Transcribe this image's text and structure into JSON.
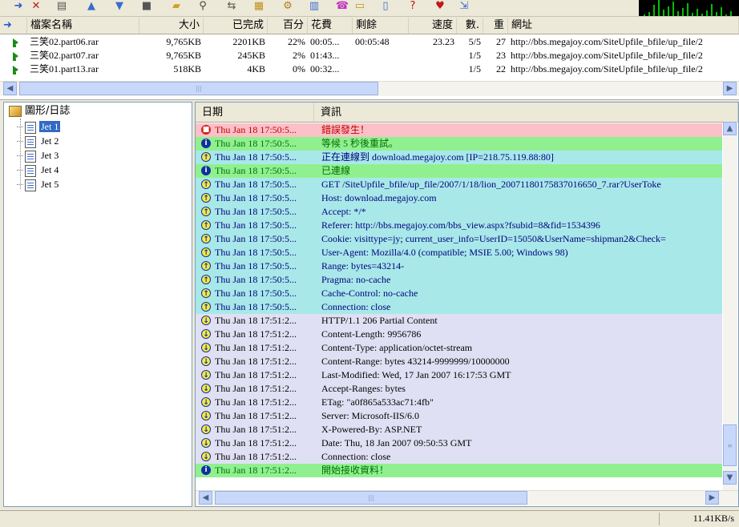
{
  "toolbar": {
    "buttons": [
      {
        "name": "add-icon",
        "glyph": "➜",
        "color": "#2a5bd0"
      },
      {
        "name": "delete-icon",
        "glyph": "✕",
        "color": "#c01818"
      },
      {
        "name": "trash-icon",
        "glyph": "▤",
        "color": "#555555"
      },
      {
        "name": "move-up-icon",
        "glyph": "▲",
        "color": "#3a6bd0"
      },
      {
        "name": "move-down-icon",
        "glyph": "▼",
        "color": "#3a6bd0"
      },
      {
        "name": "stop-all-icon",
        "glyph": "■",
        "color": "#555555"
      },
      {
        "name": "open-folder-icon",
        "glyph": "▰",
        "color": "#d0a020"
      },
      {
        "name": "find-icon",
        "glyph": "⚲",
        "color": "#444444"
      },
      {
        "name": "properties-icon",
        "glyph": "⇆",
        "color": "#555555"
      },
      {
        "name": "schedule-icon",
        "glyph": "▦",
        "color": "#c09020"
      },
      {
        "name": "options-icon",
        "glyph": "⚙",
        "color": "#b08020"
      },
      {
        "name": "site-manager-icon",
        "glyph": "▥",
        "color": "#3a6bd0"
      },
      {
        "name": "dial-icon",
        "glyph": "☎",
        "color": "#c030c0"
      },
      {
        "name": "modem-icon",
        "glyph": "▭",
        "color": "#c09020"
      },
      {
        "name": "notes-icon",
        "glyph": "▯",
        "color": "#3a6bd0"
      },
      {
        "name": "help-icon",
        "glyph": "?",
        "color": "#c01818"
      },
      {
        "name": "favorites-icon",
        "glyph": "♥",
        "color": "#c01818"
      },
      {
        "name": "exit-icon",
        "glyph": "⇲",
        "color": "#3a6bd0"
      }
    ],
    "graph_spikes": [
      2,
      5,
      14,
      20,
      8,
      12,
      18,
      6,
      10,
      16,
      4,
      9,
      3,
      7,
      15,
      5,
      11,
      2,
      6
    ]
  },
  "downloads": {
    "columns": [
      {
        "label": "檔案名稱",
        "align": "l"
      },
      {
        "label": "大小",
        "align": "r"
      },
      {
        "label": "已完成",
        "align": "r"
      },
      {
        "label": "百分",
        "align": "r"
      },
      {
        "label": "花費",
        "align": "l"
      },
      {
        "label": "剩餘",
        "align": "l"
      },
      {
        "label": "速度",
        "align": "r"
      },
      {
        "label": "數.",
        "align": "r"
      },
      {
        "label": "重",
        "align": "r"
      },
      {
        "label": "網址",
        "align": "l"
      }
    ],
    "rows": [
      [
        "三笑02.part06.rar",
        "9,765KB",
        "2201KB",
        "22%",
        "00:05...",
        "00:05:48",
        "23.23",
        "5/5",
        "27",
        "http://bbs.megajoy.com/SiteUpfile_bfile/up_file/2"
      ],
      [
        "三笑02.part07.rar",
        "9,765KB",
        "245KB",
        "2%",
        "01:43...",
        "",
        "",
        "1/5",
        "23",
        "http://bbs.megajoy.com/SiteUpfile_bfile/up_file/2"
      ],
      [
        "三笑01.part13.rar",
        "518KB",
        "4KB",
        "0%",
        "00:32...",
        "",
        "",
        "1/5",
        "22",
        "http://bbs.megajoy.com/SiteUpfile_bfile/up_file/2"
      ]
    ]
  },
  "tree": {
    "root": "圖形/日誌",
    "items": [
      "Jet 1",
      "Jet 2",
      "Jet 3",
      "Jet 4",
      "Jet 5"
    ],
    "selected": 0
  },
  "log": {
    "columns": [
      "日期",
      "資訊"
    ],
    "rows": [
      {
        "t": "err",
        "d": "Thu Jan 18 17:50:5...",
        "m": "錯誤發生！"
      },
      {
        "t": "info",
        "d": "Thu Jan 18 17:50:5...",
        "m": "等候 5 秒後重試。"
      },
      {
        "t": "send",
        "d": "Thu Jan 18 17:50:5...",
        "m": "正在連線到 download.megajoy.com [IP=218.75.119.88:80]"
      },
      {
        "t": "info",
        "d": "Thu Jan 18 17:50:5...",
        "m": "已連線"
      },
      {
        "t": "send",
        "d": "Thu Jan 18 17:50:5...",
        "m": "GET /SiteUpfile_bfile/up_file/2007/1/18/lion_20071180175837016650_7.rar?UserToke"
      },
      {
        "t": "send",
        "d": "Thu Jan 18 17:50:5...",
        "m": "Host: download.megajoy.com"
      },
      {
        "t": "send",
        "d": "Thu Jan 18 17:50:5...",
        "m": "Accept: */*"
      },
      {
        "t": "send",
        "d": "Thu Jan 18 17:50:5...",
        "m": "Referer: http://bbs.megajoy.com/bbs_view.aspx?fsubid=8&fid=1534396"
      },
      {
        "t": "send",
        "d": "Thu Jan 18 17:50:5...",
        "m": "Cookie: visittype=jy; current_user_info=UserID=15050&UserName=shipman2&Check="
      },
      {
        "t": "send",
        "d": "Thu Jan 18 17:50:5...",
        "m": "User-Agent: Mozilla/4.0 (compatible; MSIE 5.00; Windows 98)"
      },
      {
        "t": "send",
        "d": "Thu Jan 18 17:50:5...",
        "m": "Range: bytes=43214-"
      },
      {
        "t": "send",
        "d": "Thu Jan 18 17:50:5...",
        "m": "Pragma: no-cache"
      },
      {
        "t": "send",
        "d": "Thu Jan 18 17:50:5...",
        "m": "Cache-Control: no-cache"
      },
      {
        "t": "send",
        "d": "Thu Jan 18 17:50:5...",
        "m": "Connection: close"
      },
      {
        "t": "recv",
        "d": "Thu Jan 18 17:51:2...",
        "m": "HTTP/1.1 206 Partial Content"
      },
      {
        "t": "recv",
        "d": "Thu Jan 18 17:51:2...",
        "m": "Content-Length: 9956786"
      },
      {
        "t": "recv",
        "d": "Thu Jan 18 17:51:2...",
        "m": "Content-Type: application/octet-stream"
      },
      {
        "t": "recv",
        "d": "Thu Jan 18 17:51:2...",
        "m": "Content-Range: bytes 43214-9999999/10000000"
      },
      {
        "t": "recv",
        "d": "Thu Jan 18 17:51:2...",
        "m": "Last-Modified: Wed, 17 Jan 2007 16:17:53 GMT"
      },
      {
        "t": "recv",
        "d": "Thu Jan 18 17:51:2...",
        "m": "Accept-Ranges: bytes"
      },
      {
        "t": "recv",
        "d": "Thu Jan 18 17:51:2...",
        "m": "ETag: \"a0f865a533ac71:4fb\""
      },
      {
        "t": "recv",
        "d": "Thu Jan 18 17:51:2...",
        "m": "Server: Microsoft-IIS/6.0"
      },
      {
        "t": "recv",
        "d": "Thu Jan 18 17:51:2...",
        "m": "X-Powered-By: ASP.NET"
      },
      {
        "t": "recv",
        "d": "Thu Jan 18 17:51:2...",
        "m": "Date: Thu, 18 Jan 2007 09:50:53 GMT"
      },
      {
        "t": "recv",
        "d": "Thu Jan 18 17:51:2...",
        "m": "Connection: close"
      },
      {
        "t": "info",
        "d": "Thu Jan 18 17:51:2...",
        "m": "開始接收資料！"
      }
    ],
    "styles": {
      "err": {
        "bg": "#fcc0c8",
        "fg": "#c00000"
      },
      "info": {
        "bg": "#90f090",
        "fg": "#007000"
      },
      "send": {
        "bg": "#a8e8e8",
        "fg": "#000080"
      },
      "recv": {
        "bg": "#e0e0f4",
        "fg": "#000000"
      }
    }
  },
  "status": {
    "speed": "11.41KB/s"
  }
}
